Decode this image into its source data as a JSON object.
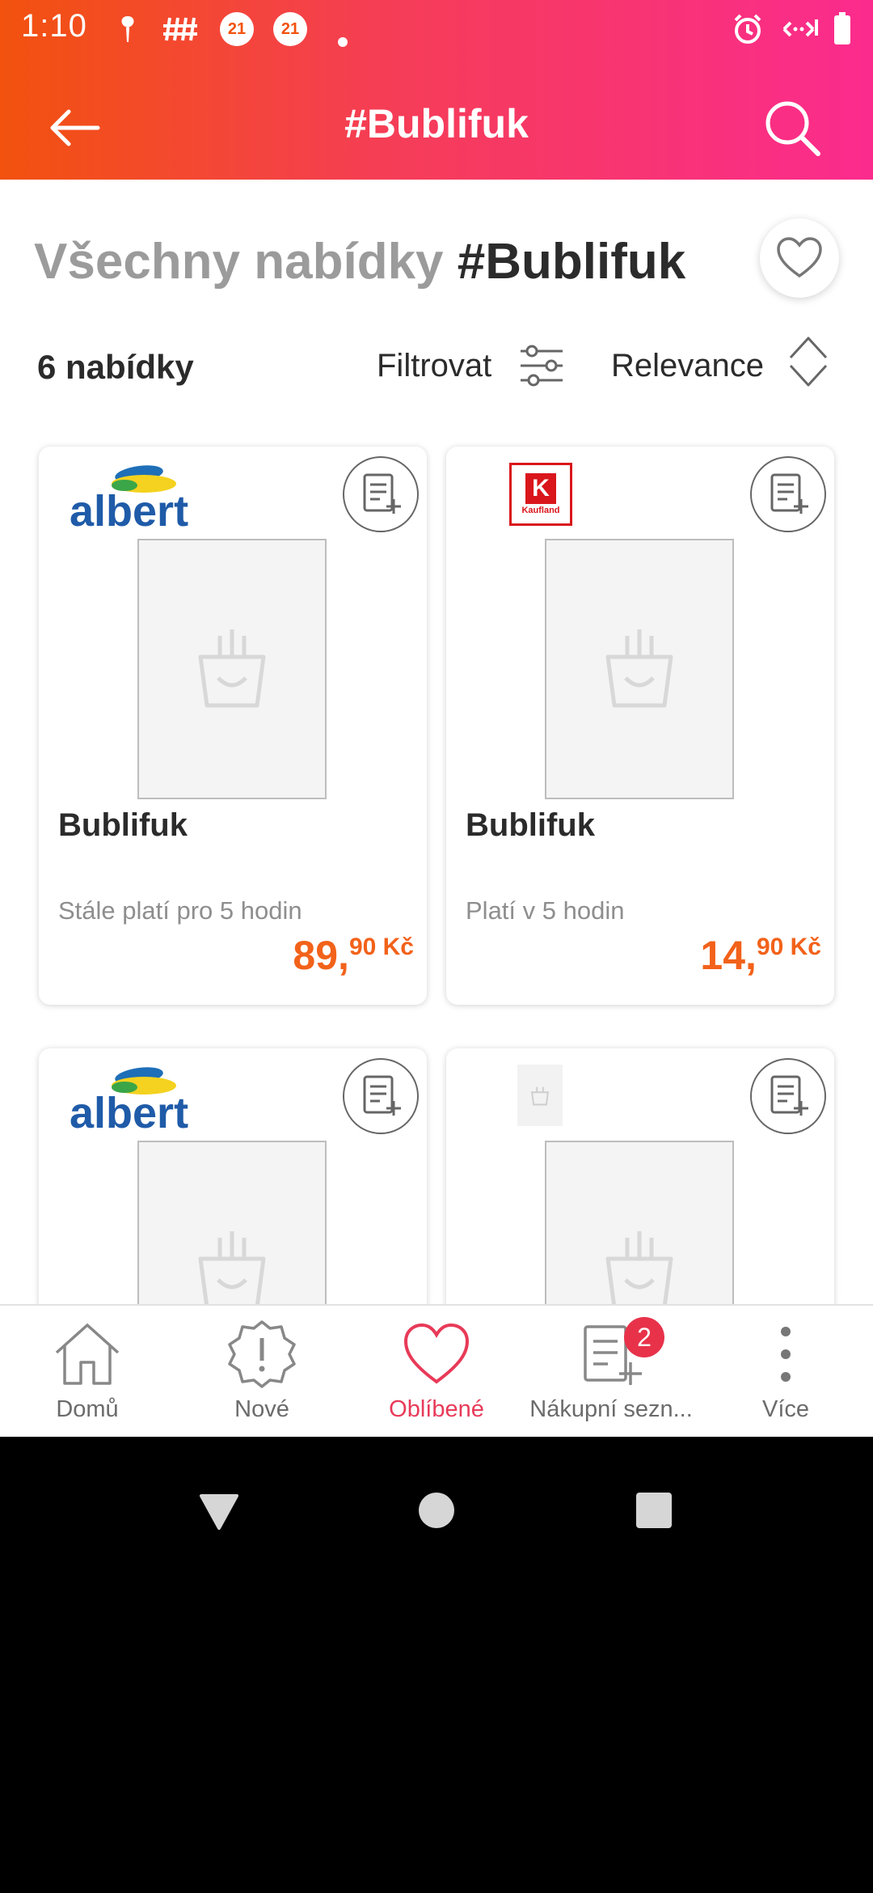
{
  "status_bar": {
    "time": "1:10",
    "badge_a": "21",
    "badge_b": "21"
  },
  "app_bar": {
    "title": "#Bublifuk"
  },
  "header": {
    "heading_prefix": "Všechny nabídky",
    "heading_tag": "#Bublifuk"
  },
  "toolbar": {
    "count": "6 nabídky",
    "filter_label": "Filtrovat",
    "sort_label": "Relevance"
  },
  "offers": [
    {
      "store": "albert",
      "name": "Bublifuk",
      "validity": "Stále platí pro 5 hodin",
      "price_main": "89,",
      "price_decimal": "90 Kč"
    },
    {
      "store": "Kaufland",
      "name": "Bublifuk",
      "validity": "Platí v 5 hodin",
      "price_main": "14,",
      "price_decimal": "90 Kč"
    },
    {
      "store": "albert",
      "name": "",
      "validity": "",
      "price_main": "",
      "price_decimal": ""
    },
    {
      "store": "",
      "name": "",
      "validity": "",
      "price_main": "",
      "price_decimal": ""
    }
  ],
  "bottom_nav": {
    "items": [
      {
        "label": "Domů",
        "icon": "home-icon"
      },
      {
        "label": "Nové",
        "icon": "new-badge-icon"
      },
      {
        "label": "Oblíbené",
        "icon": "heart-icon",
        "active": true
      },
      {
        "label": "Nákupní sezn...",
        "icon": "shopping-list-icon",
        "badge": "2"
      },
      {
        "label": "Více",
        "icon": "more-vert-icon"
      }
    ]
  },
  "colors": {
    "accent": "#e83a58",
    "price": "#f2621a",
    "gradient_start": "#f2520e",
    "gradient_end": "#fb2b8e"
  }
}
